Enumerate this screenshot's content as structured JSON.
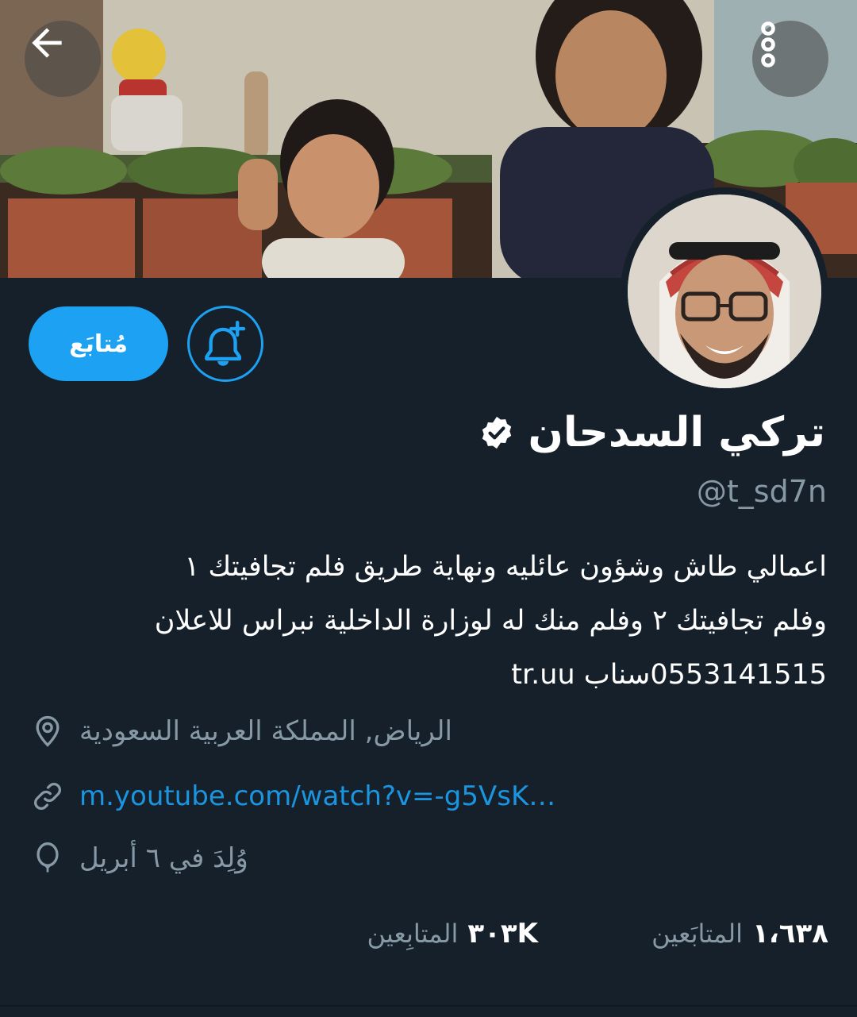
{
  "profile": {
    "display_name": "تركي السدحان",
    "handle": "@t_sd7n",
    "verified_icon": "verified-badge-icon",
    "bio_lines": [
      "اعمالي طاش وشؤون عائليه ونهاية طريق فلم تجافيتك ١",
      "وفلم تجافيتك ٢ وفلم منك له لوزارة الداخلية نبراس للاعلان",
      "0553141515سناب tr.uu"
    ],
    "location": "الرياض, المملكة العربية السعودية",
    "website": "m.youtube.com/watch?v=-g5VsK…",
    "birthday": "وُلِدَ في ٦ أبريل"
  },
  "actions": {
    "follow_label": "مُتابَع",
    "back_icon": "arrow-left-icon",
    "more_icon": "more-vertical-icon",
    "notify_icon": "bell-plus-icon"
  },
  "stats": {
    "following_count": "١،٦٣٨",
    "following_label": "المتابَعين",
    "followers_count": "٣٠٣K",
    "followers_label": "المتابِعين"
  },
  "colors": {
    "background": "#15202b",
    "accent": "#1da1f2",
    "link": "#1b95e0",
    "muted": "#8899a6"
  }
}
